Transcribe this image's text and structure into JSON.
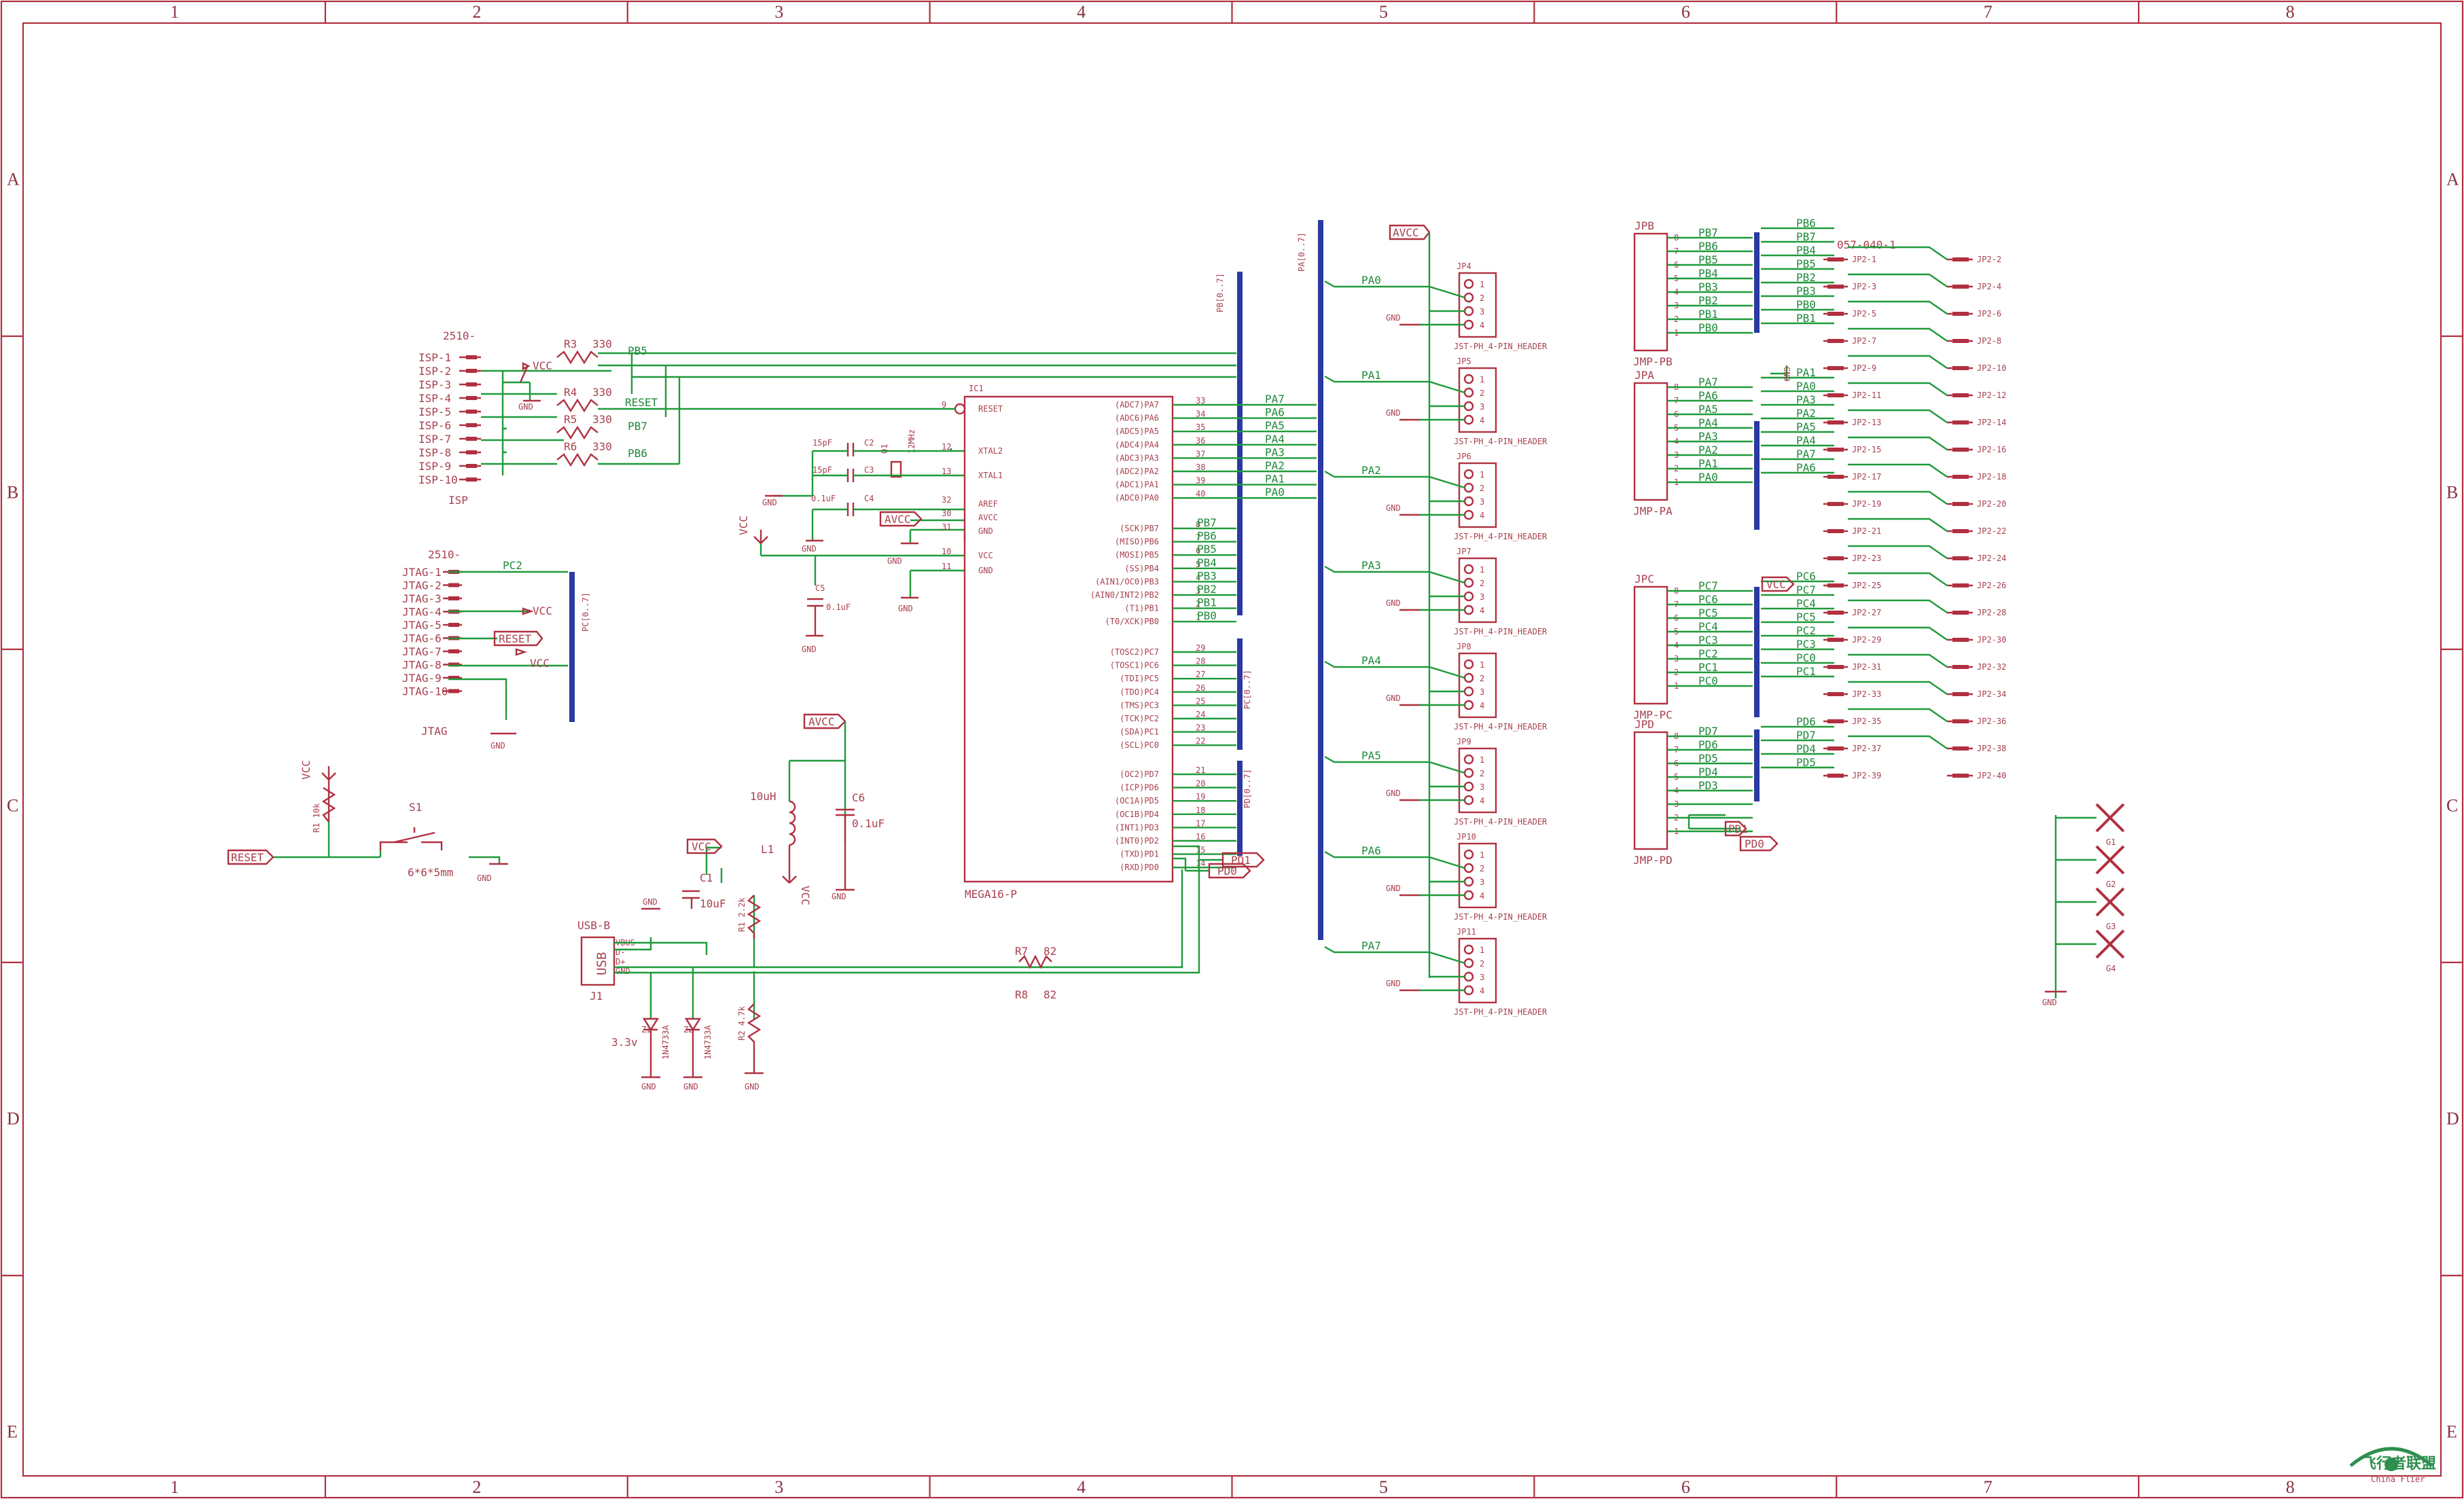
{
  "frame": {
    "columns": [
      "1",
      "2",
      "3",
      "4",
      "5",
      "6",
      "7",
      "8"
    ],
    "rows": [
      "A",
      "B",
      "C",
      "D",
      "E"
    ]
  },
  "isp": {
    "title": "2510-",
    "pins": [
      "ISP-1",
      "ISP-2",
      "ISP-3",
      "ISP-4",
      "ISP-5",
      "ISP-6",
      "ISP-7",
      "ISP-8",
      "ISP-9",
      "ISP-10"
    ],
    "name": "ISP",
    "vcc": "VCC",
    "gnd": "GND",
    "resistors": [
      {
        "ref": "R3",
        "value": "330",
        "net": "PB5"
      },
      {
        "ref": "R4",
        "value": "330",
        "net": "RESET"
      },
      {
        "ref": "R5",
        "value": "330",
        "net": "PB7"
      },
      {
        "ref": "R6",
        "value": "330",
        "net": "PB6"
      }
    ]
  },
  "jtag": {
    "title": "2510-",
    "pins": [
      "JTAG-1",
      "JTAG-2",
      "JTAG-3",
      "JTAG-4",
      "JTAG-5",
      "JTAG-6",
      "JTAG-7",
      "JTAG-8",
      "JTAG-9",
      "JTAG-10"
    ],
    "name": "JTAG",
    "net_top": "PC2",
    "vcc": "VCC",
    "reset": "RESET",
    "vcc2": "VCC",
    "gnd": "GND",
    "bus": "PC[0..7]"
  },
  "reset": {
    "port": "RESET",
    "switch": "S1",
    "switch_size": "6*6*5mm",
    "vcc": "VCC",
    "resistor": "R1 10k",
    "gnd": "GND"
  },
  "osc": {
    "c2": "C2",
    "c2v": "15pF",
    "c3": "C3",
    "c3v": "15pF",
    "crystal": "Q1",
    "crystal_v": "12MHz",
    "c4": "C4",
    "c4v": "0.1uF",
    "c5": "C5",
    "c5v": "0.1uF",
    "avcc": "AVCC",
    "vcc": "VCC",
    "gnd": "GND"
  },
  "mcu": {
    "ref": "IC1",
    "part": "MEGA16-P",
    "left_pins": [
      {
        "name": "RESET",
        "num": "9"
      },
      {
        "name": "XTAL2",
        "num": "12"
      },
      {
        "name": "XTAL1",
        "num": "13"
      },
      {
        "name": "AREF",
        "num": "32"
      },
      {
        "name": "AVCC",
        "num": "30"
      },
      {
        "name": "GND",
        "num": "31"
      },
      {
        "name": "VCC",
        "num": "10"
      },
      {
        "name": "GND",
        "num": "11"
      }
    ],
    "right_pins": [
      {
        "name": "(ADC7)PA7",
        "num": "33"
      },
      {
        "name": "(ADC6)PA6",
        "num": "34"
      },
      {
        "name": "(ADC5)PA5",
        "num": "35"
      },
      {
        "name": "(ADC4)PA4",
        "num": "36"
      },
      {
        "name": "(ADC3)PA3",
        "num": "37"
      },
      {
        "name": "(ADC2)PA2",
        "num": "38"
      },
      {
        "name": "(ADC1)PA1",
        "num": "39"
      },
      {
        "name": "(ADC0)PA0",
        "num": "40"
      },
      {
        "name": "(SCK)PB7",
        "num": "8"
      },
      {
        "name": "(MISO)PB6",
        "num": "7"
      },
      {
        "name": "(MOSI)PB5",
        "num": "6"
      },
      {
        "name": "(SS)PB4",
        "num": "5"
      },
      {
        "name": "(AIN1/OC0)PB3",
        "num": "4"
      },
      {
        "name": "(AIN0/INT2)PB2",
        "num": "3"
      },
      {
        "name": "(T1)PB1",
        "num": "2"
      },
      {
        "name": "(T0/XCK)PB0",
        "num": "1"
      },
      {
        "name": "(TOSC2)PC7",
        "num": "29"
      },
      {
        "name": "(TOSC1)PC6",
        "num": "28"
      },
      {
        "name": "(TDI)PC5",
        "num": "27"
      },
      {
        "name": "(TDO)PC4",
        "num": "26"
      },
      {
        "name": "(TMS)PC3",
        "num": "25"
      },
      {
        "name": "(TCK)PC2",
        "num": "24"
      },
      {
        "name": "(SDA)PC1",
        "num": "23"
      },
      {
        "name": "(SCL)PC0",
        "num": "22"
      },
      {
        "name": "(OC2)PD7",
        "num": "21"
      },
      {
        "name": "(ICP)PD6",
        "num": "20"
      },
      {
        "name": "(OC1A)PD5",
        "num": "19"
      },
      {
        "name": "(OC1B)PD4",
        "num": "18"
      },
      {
        "name": "(INT1)PD3",
        "num": "17"
      },
      {
        "name": "(INT0)PD2",
        "num": "16"
      },
      {
        "name": "(TXD)PD1",
        "num": "15"
      },
      {
        "name": "(RXD)PD0",
        "num": "14"
      }
    ],
    "pa_nets": [
      "PA7",
      "PA6",
      "PA5",
      "PA4",
      "PA3",
      "PA2",
      "PA1",
      "PA0"
    ],
    "pb_nets": [
      "PB7",
      "PB6",
      "PB5",
      "PB4",
      "PB3",
      "PB2",
      "PB1",
      "PB0"
    ],
    "pb_bus": "PB[0..7]",
    "pc_bus": "PC[0..7]",
    "pd_bus": "PD[0..7]",
    "pd1": "PD1",
    "pd0": "PD0"
  },
  "filter": {
    "avcc": "AVCC",
    "inductor": "L1",
    "inductor_v": "10uH",
    "cap": "C6",
    "cap_v": "0.1uF",
    "vcc": "VCC",
    "gnd": "GND"
  },
  "usb": {
    "ref": "J1",
    "part": "USB-B",
    "label": "USB",
    "pins": [
      "VBUS",
      "D-",
      "D+",
      "GND"
    ],
    "vcc": "VCC",
    "gnd": "GND",
    "c1": "C1",
    "c1v": "10uF",
    "r1": "R1 2.2k",
    "r2": "R2 4.7k",
    "r7": "R7",
    "r7v": "82",
    "r8": "R8",
    "r8v": "82",
    "z1": "Z1",
    "z1v": "1N4733A",
    "z2": "Z2",
    "z2v": "1N4733A",
    "v33": "3.3v"
  },
  "pa_bus": {
    "label": "PA[0..7]",
    "avcc": "AVCC",
    "gnd": "GND",
    "headers": [
      {
        "ref": "JP4",
        "net": "PA0"
      },
      {
        "ref": "JP5",
        "net": "PA1"
      },
      {
        "ref": "JP6",
        "net": "PA2"
      },
      {
        "ref": "JP7",
        "net": "PA3"
      },
      {
        "ref": "JP8",
        "net": "PA4"
      },
      {
        "ref": "JP9",
        "net": "PA5"
      },
      {
        "ref": "JP10",
        "net": "PA6"
      },
      {
        "ref": "JP11",
        "net": "PA7"
      }
    ],
    "header_part": "JST-PH_4-PIN_HEADER",
    "pin_nums": [
      "1",
      "2",
      "3",
      "4"
    ]
  },
  "right": {
    "jp2_title": "057-040-1",
    "jmp_pb": {
      "ref": "JPB",
      "part": "JMP-PB",
      "nets": [
        "PB7",
        "PB6",
        "PB5",
        "PB4",
        "PB3",
        "PB2",
        "PB1",
        "PB0"
      ],
      "out": [
        "PB6",
        "PB7",
        "PB4",
        "PB5",
        "PB2",
        "PB3",
        "PB0",
        "PB1"
      ]
    },
    "jmp_pa": {
      "ref": "JPA",
      "part": "JMP-PA",
      "nets": [
        "PA7",
        "PA6",
        "PA5",
        "PA4",
        "PA3",
        "PA2",
        "PA1",
        "PA0"
      ],
      "out": [
        "PA1",
        "PA0",
        "PA3",
        "PA2",
        "PA5",
        "PA4",
        "PA7",
        "PA6"
      ]
    },
    "jmp_pc": {
      "ref": "JPC",
      "part": "JMP-PC",
      "nets": [
        "PC7",
        "PC6",
        "PC5",
        "PC4",
        "PC3",
        "PC2",
        "PC1",
        "PC0"
      ],
      "out": [
        "PC6",
        "PC7",
        "PC4",
        "PC5",
        "PC2",
        "PC3",
        "PC0",
        "PC1"
      ]
    },
    "jmp_pd": {
      "ref": "JPD",
      "part": "JMP-PD",
      "nets": [
        "PD7",
        "PD6",
        "PD5",
        "PD4",
        "PD3"
      ],
      "out": [
        "PD6",
        "PD7",
        "PD4",
        "PD5"
      ]
    },
    "pin_nums": [
      "8",
      "7",
      "6",
      "5",
      "4",
      "3",
      "2",
      "1"
    ],
    "gnd": "GND",
    "vcc": "VCC",
    "pd1": "PD1",
    "pd0": "PD0",
    "left_jp2": [
      "JP2-1",
      "JP2-3",
      "JP2-5",
      "JP2-7",
      "JP2-9",
      "JP2-11",
      "JP2-13",
      "JP2-15",
      "JP2-17",
      "JP2-19",
      "JP2-21",
      "JP2-23",
      "JP2-25",
      "JP2-27",
      "JP2-29",
      "JP2-31",
      "JP2-33",
      "JP2-35",
      "JP2-37",
      "JP2-39"
    ],
    "right_jp2": [
      "JP2-2",
      "JP2-4",
      "JP2-6",
      "JP2-8",
      "JP2-10",
      "JP2-12",
      "JP2-14",
      "JP2-16",
      "JP2-18",
      "JP2-20",
      "JP2-22",
      "JP2-24",
      "JP2-26",
      "JP2-28",
      "JP2-30",
      "JP2-32",
      "JP2-34",
      "JP2-36",
      "JP2-38",
      "JP2-40"
    ]
  },
  "mount": {
    "holes": [
      "G1",
      "G2",
      "G3",
      "G4"
    ],
    "gnd": "GND"
  },
  "logo": {
    "text": "飞行者联盟",
    "sub": "China Flier"
  }
}
